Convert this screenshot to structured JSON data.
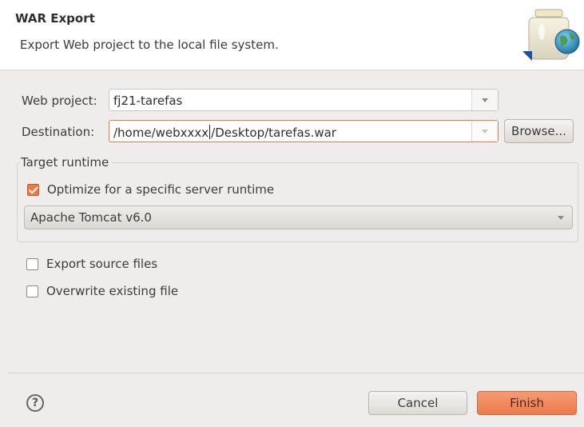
{
  "header": {
    "title": "WAR Export",
    "description": "Export Web project to the local file system."
  },
  "web_project": {
    "label": "Web project:",
    "value": "fj21-tarefas"
  },
  "destination": {
    "label": "Destination:",
    "value_before_caret": "/home/webxxxx",
    "value_after_caret": "/Desktop/tarefas.war",
    "browse_label": "Browse..."
  },
  "target_runtime": {
    "group_title": "Target runtime",
    "optimize_label": "Optimize for a specific server runtime",
    "optimize_checked": true,
    "runtime_value": "Apache Tomcat v6.0"
  },
  "options": {
    "export_source_label": "Export source files",
    "export_source_checked": false,
    "overwrite_label": "Overwrite existing file",
    "overwrite_checked": false
  },
  "footer": {
    "help_symbol": "?",
    "cancel_label": "Cancel",
    "finish_label": "Finish"
  },
  "colors": {
    "accent": "#f07746",
    "background": "#efedeb"
  }
}
